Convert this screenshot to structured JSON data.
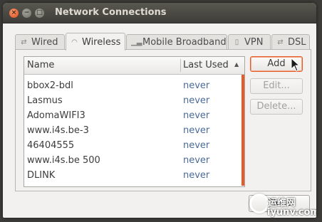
{
  "window": {
    "title": "Network Connections"
  },
  "tabs": [
    {
      "label": "Wired",
      "icon": "wired-network-icon"
    },
    {
      "label": "Wireless",
      "icon": "wireless-signal-icon",
      "active": true
    },
    {
      "label": "Mobile Broadband",
      "icon": "mobile-signal-icon"
    },
    {
      "label": "VPN",
      "icon": "vpn-lock-icon"
    },
    {
      "label": "DSL",
      "icon": "dsl-icon"
    }
  ],
  "list": {
    "columns": {
      "name": "Name",
      "last_used": "Last Used"
    },
    "rows": [
      {
        "name": "bbox2-bdl",
        "last_used": "never"
      },
      {
        "name": "Lasmus",
        "last_used": "never"
      },
      {
        "name": "AdomaWIFI3",
        "last_used": "never"
      },
      {
        "name": "www.i4s.be-3",
        "last_used": "never"
      },
      {
        "name": "46404555",
        "last_used": "never"
      },
      {
        "name": "www.i4s.be 500",
        "last_used": "never"
      },
      {
        "name": "DLINK",
        "last_used": "never"
      }
    ]
  },
  "buttons": {
    "add": "Add",
    "edit": "Edit...",
    "delete": "Delete...",
    "close": "Close"
  },
  "watermark": {
    "line1": "运维网",
    "line2": "iyunv.com"
  },
  "colors": {
    "accent": "#e65c28",
    "titlebar": "#3e3d39",
    "window_bg": "#f2f1f0"
  }
}
